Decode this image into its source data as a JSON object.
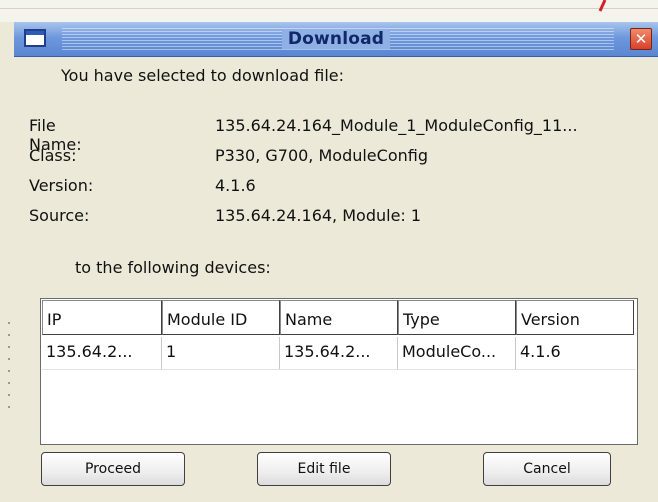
{
  "window": {
    "title": "Download",
    "close_glyph": "✕"
  },
  "intro_text": "You have selected to download file:",
  "details": [
    {
      "key": "File Name:",
      "value": "135.64.24.164_Module_1_ModuleConfig_11..."
    },
    {
      "key": "Class:",
      "value": "P330, G700, ModuleConfig"
    },
    {
      "key": "Version:",
      "value": "4.1.6"
    },
    {
      "key": "Source:",
      "value": "135.64.24.164, Module: 1"
    }
  ],
  "devices_label": "to the following devices:",
  "table": {
    "columns": [
      "IP",
      "Module ID",
      "Name",
      "Type",
      "Version"
    ],
    "rows": [
      [
        "135.64.2...",
        "1",
        "135.64.2...",
        "ModuleCo...",
        "4.1.6"
      ]
    ]
  },
  "buttons": {
    "proceed": "Proceed",
    "edit_file": "Edit file",
    "cancel": "Cancel"
  },
  "colors": {
    "titlebar": "#6f98dc",
    "title_text": "#10276a",
    "close_button": "#d8402a",
    "dialog_background": "#ece9d8"
  },
  "icons": {
    "window": "window-icon",
    "close": "close-icon"
  }
}
